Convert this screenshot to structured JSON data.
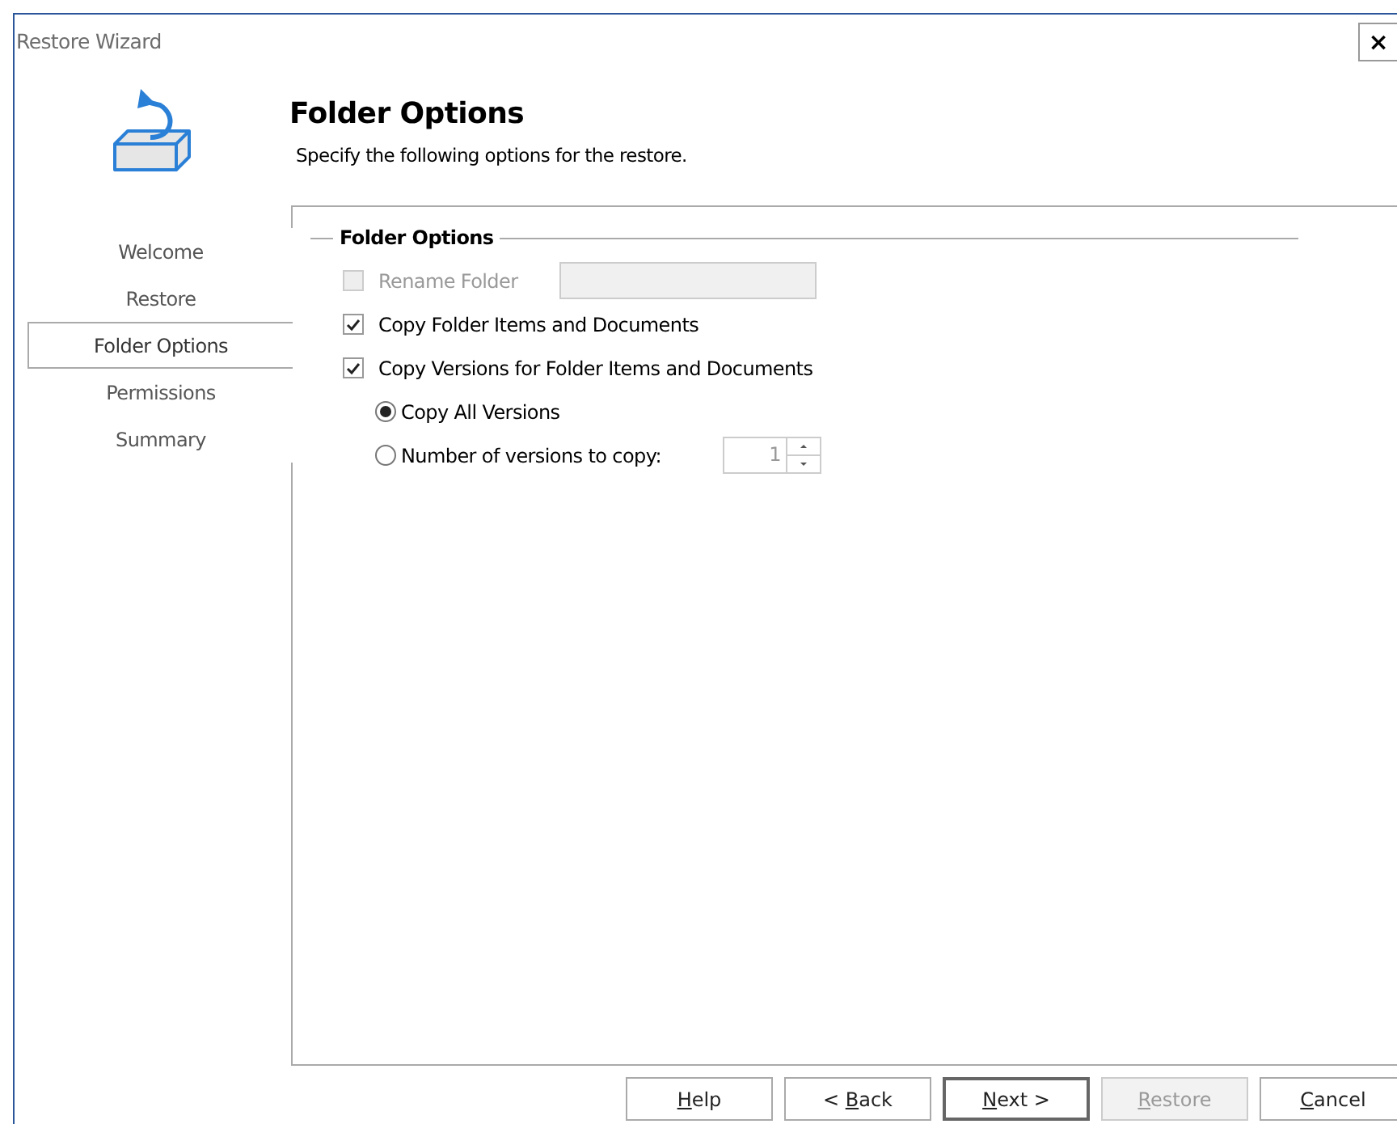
{
  "window": {
    "title": "Restore Wizard",
    "close": "×"
  },
  "header": {
    "title": "Folder Options",
    "subtitle": "Specify the following options for the restore."
  },
  "steps": [
    {
      "label": "Welcome",
      "selected": false
    },
    {
      "label": "Restore",
      "selected": false
    },
    {
      "label": "Folder Options",
      "selected": true
    },
    {
      "label": "Permissions",
      "selected": false
    },
    {
      "label": "Summary",
      "selected": false
    }
  ],
  "group": {
    "title": "Folder Options"
  },
  "options": [
    {
      "kind": "checkbox_field",
      "label": "Rename Folder",
      "checked": false,
      "disabled": true
    },
    {
      "kind": "checkbox",
      "label": "Copy Folder Items and Documents",
      "checked": true,
      "disabled": false
    },
    {
      "kind": "checkbox",
      "label": "Copy Versions for Folder Items and  Documents",
      "checked": true,
      "disabled": false
    },
    {
      "kind": "radio",
      "label": "Copy All Versions",
      "selected": true,
      "disabled": false
    },
    {
      "kind": "radio_spinner",
      "label": "Number of versions to copy:",
      "selected": false,
      "disabled": false,
      "value": "1"
    }
  ],
  "buttons": [
    {
      "key": "H",
      "after": "elp",
      "disabled": false,
      "default": false
    },
    {
      "before": "< ",
      "key": "B",
      "after": "ack",
      "disabled": false,
      "default": false
    },
    {
      "key": "N",
      "after": "ext >",
      "disabled": false,
      "default": true
    },
    {
      "key": "R",
      "after": "estore",
      "disabled": true,
      "default": false
    },
    {
      "key": "C",
      "after": "ancel",
      "disabled": false,
      "default": false
    }
  ]
}
